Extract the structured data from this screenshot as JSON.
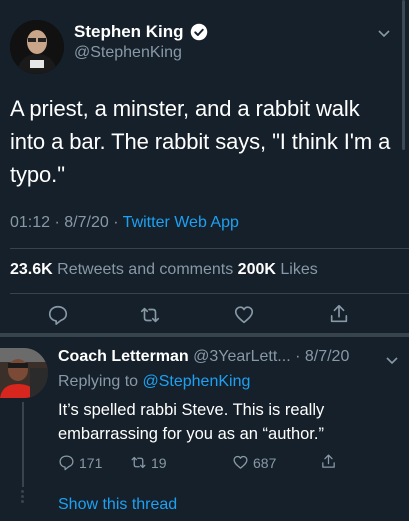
{
  "tweet": {
    "display_name": "Stephen King",
    "handle": "@StephenKing",
    "text": "A priest, a minster, and a rabbit walk into a bar. The rabbit says, \"I think I'm a typo.\"",
    "time": "01:12 · 8/7/20 · ",
    "source": "Twitter Web App",
    "retweets_count": "23.6K",
    "retweets_label": " Retweets and comments ",
    "likes_count": "200K",
    "likes_label": " Likes"
  },
  "reply": {
    "display_name": "Coach Letterman",
    "handle_date": " @3YearLett... · 8/7/20",
    "replying_prefix": "Replying to ",
    "replying_mention": "@StephenKing",
    "text": "It’s spelled rabbi Steve. This is really embarrassing for you as an “author.”",
    "replies_count": "171",
    "retweets_count": "19",
    "likes_count": "687",
    "show_thread": "Show this thread"
  },
  "colors": {
    "background": "#15202b",
    "text_primary": "#ffffff",
    "text_secondary": "#8899a6",
    "accent": "#1da1f2",
    "divider": "#38444d"
  }
}
